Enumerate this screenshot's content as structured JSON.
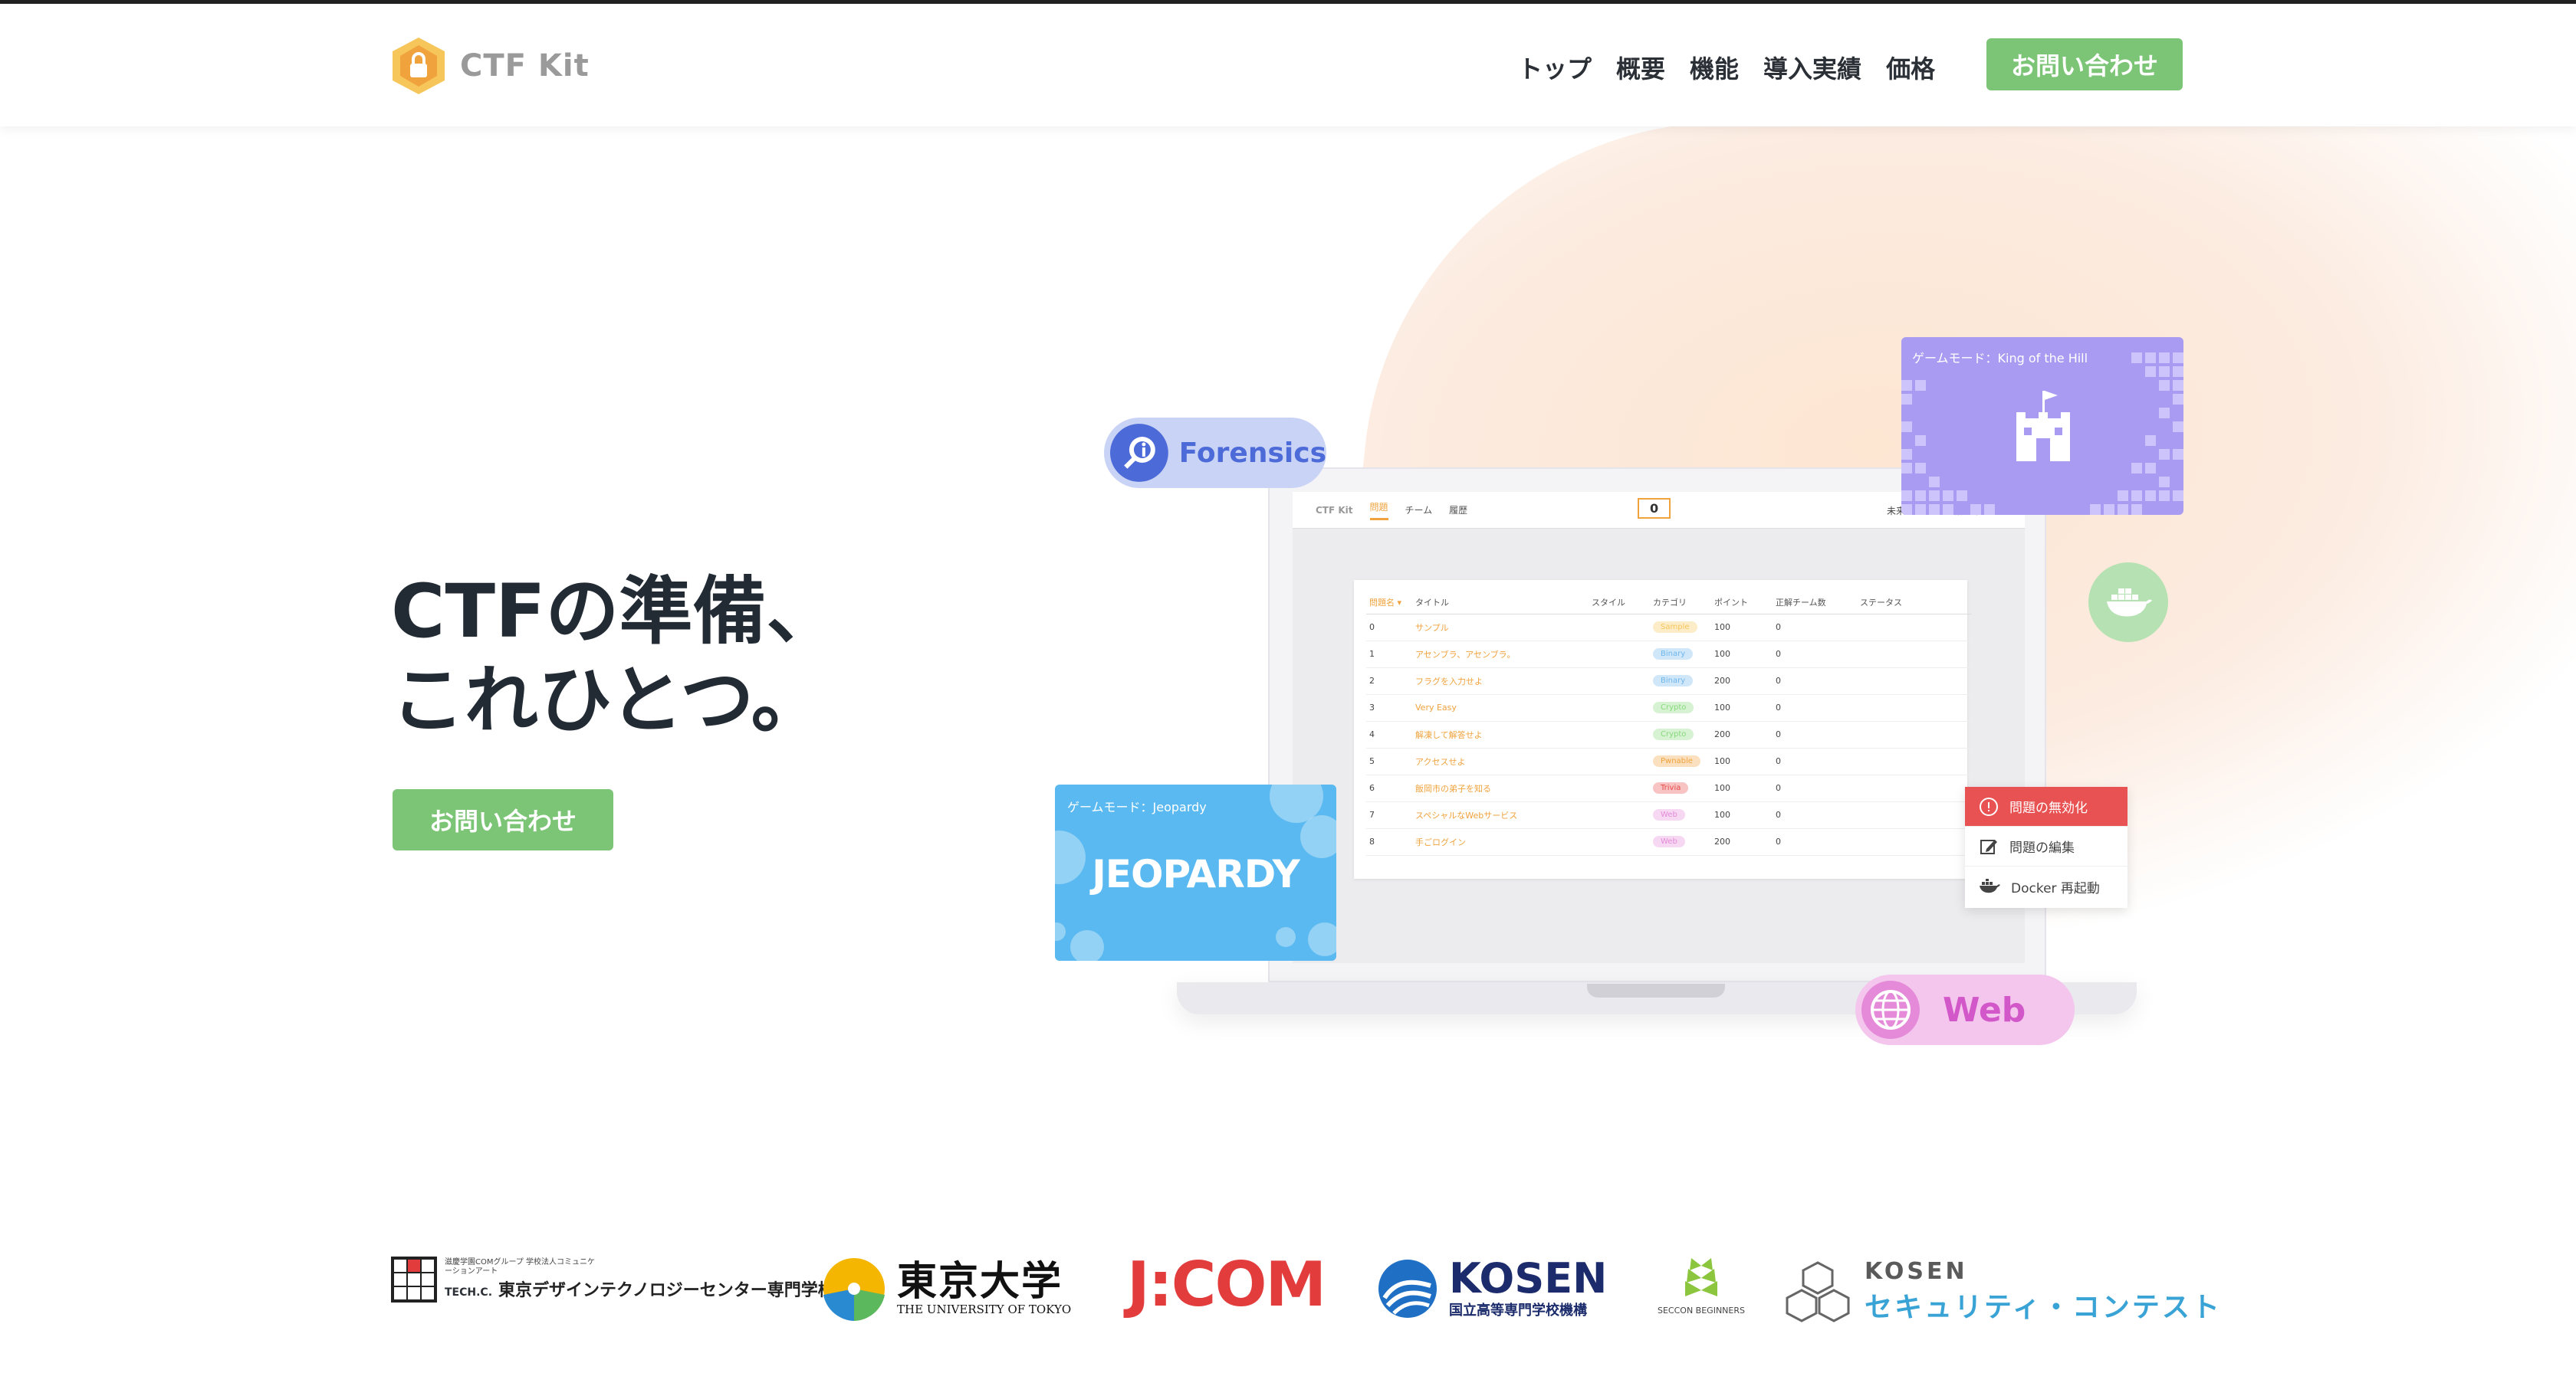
{
  "header": {
    "logo_text": "CTF Kit",
    "nav": [
      "トップ",
      "概要",
      "機能",
      "導入実績",
      "価格"
    ],
    "cta": "お問い合わせ"
  },
  "hero": {
    "title_line1": "CTFの準備、",
    "title_line2": "これひとつ。",
    "cta": "お問い合わせ"
  },
  "app": {
    "logo": "CTF Kit",
    "tabs": [
      "問題",
      "チーム",
      "履歴"
    ],
    "score": "0",
    "team": "未来ガジェット研究所",
    "columns": [
      "問題名 ▾",
      "タイトル",
      "スタイル",
      "カテゴリ",
      "ポイント",
      "正解チーム数",
      "ステータス"
    ],
    "rows": [
      {
        "id": "0",
        "title": "サンプル",
        "category": "Sample",
        "points": "100",
        "solved": "0"
      },
      {
        "id": "1",
        "title": "アセンブラ、アセンブラ。",
        "category": "Binary",
        "points": "100",
        "solved": "0"
      },
      {
        "id": "2",
        "title": "フラグを入力せよ",
        "category": "Binary",
        "points": "200",
        "solved": "0"
      },
      {
        "id": "3",
        "title": "Very Easy",
        "category": "Crypto",
        "points": "100",
        "solved": "0"
      },
      {
        "id": "4",
        "title": "解凍して解答せよ",
        "category": "Crypto",
        "points": "200",
        "solved": "0"
      },
      {
        "id": "5",
        "title": "アクセスせよ",
        "category": "Pwnable",
        "points": "100",
        "solved": "0"
      },
      {
        "id": "6",
        "title": "飯岡市の弟子を知る",
        "category": "Trivia",
        "points": "100",
        "solved": "0"
      },
      {
        "id": "7",
        "title": "スペシャルなWebサービス",
        "category": "Web",
        "points": "100",
        "solved": "0"
      },
      {
        "id": "8",
        "title": "手ごログイン",
        "category": "Web",
        "points": "200",
        "solved": "0"
      }
    ],
    "category_colors": {
      "Sample": "#f6c65b",
      "Binary": "#6fb6ec",
      "Crypto": "#86d97a",
      "Pwnable": "#f0a23c",
      "Trivia": "#e64a4a",
      "Web": "#e48ad8"
    }
  },
  "cards": {
    "koth_label": "ゲームモード：King of the Hill",
    "jeopardy_label": "ゲームモード：Jeopardy",
    "jeopardy_word": "JEOPARDY"
  },
  "tags": {
    "forensics": "Forensics",
    "web": "Web"
  },
  "context_menu": {
    "disable": "問題の無効化",
    "edit": "問題の編集",
    "docker": "Docker 再起動"
  },
  "logos": {
    "techc_small": "滋慶学園COMグループ 学校法人コミュニケーションアート",
    "techc_brand": "TECH.C.",
    "techc_name": "東京デザインテクノロジーセンター専門学校",
    "todai_big": "東京大学",
    "todai_sub": "THE UNIVERSITY OF TOKYO",
    "jcom": "J:COM",
    "kosen_big": "KOSEN",
    "kosen_sub": "国立高等専門学校機構",
    "seccon_sub": "SECCON BEGINNERS",
    "kcontest_big": "KOSEN",
    "kcontest_sub": "セキュリティ・コンテスト"
  },
  "colors": {
    "accent_green": "#7cc576",
    "primary_text": "#222a33",
    "koth_purple": "#a99bf2",
    "jeopardy_blue": "#5ab9f0"
  }
}
